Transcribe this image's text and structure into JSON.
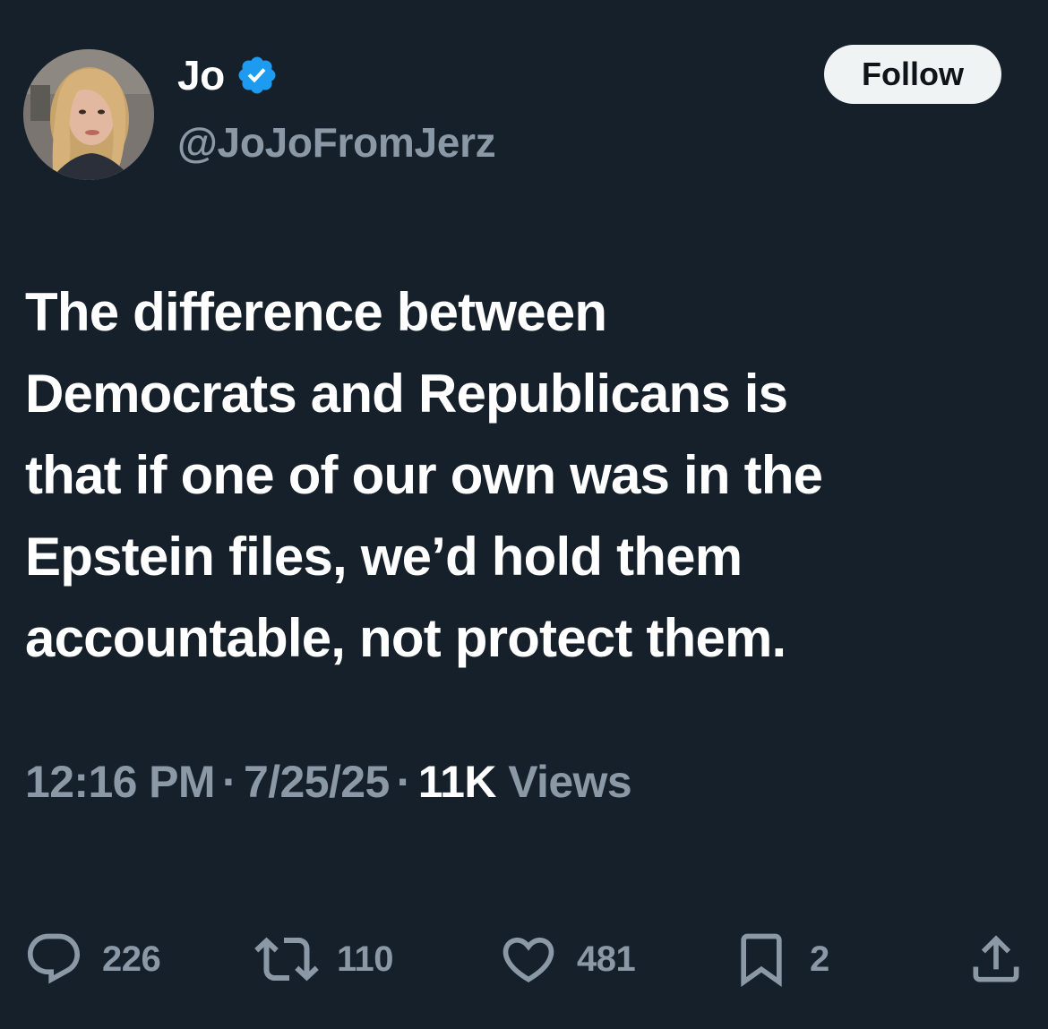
{
  "author": {
    "display_name": "Jo",
    "handle": "@JoJoFromJerz",
    "verified_icon": "verified-badge-icon",
    "avatar_icon": "profile-photo"
  },
  "follow_button": {
    "label": "Follow"
  },
  "tweet": {
    "text_lines": [
      "The difference between",
      "Democrats and Republicans is",
      "that if one of our own was in the",
      "Epstein files, we’d hold them",
      "accountable, not protect them."
    ]
  },
  "meta": {
    "time": "12:16 PM",
    "separator": "·",
    "date": "7/25/25",
    "views_count": "11K",
    "views_label": "Views"
  },
  "actions": {
    "reply": {
      "icon": "reply-icon",
      "count": "226"
    },
    "repost": {
      "icon": "repost-icon",
      "count": "110"
    },
    "like": {
      "icon": "heart-icon",
      "count": "481"
    },
    "bookmark": {
      "icon": "bookmark-icon",
      "count": "2"
    },
    "share": {
      "icon": "share-icon"
    }
  },
  "colors": {
    "background": "#15202b",
    "primary_text": "#ffffff",
    "secondary_text": "#8b98a5",
    "verified_blue": "#1d9bf0",
    "follow_bg": "#eff3f4"
  }
}
